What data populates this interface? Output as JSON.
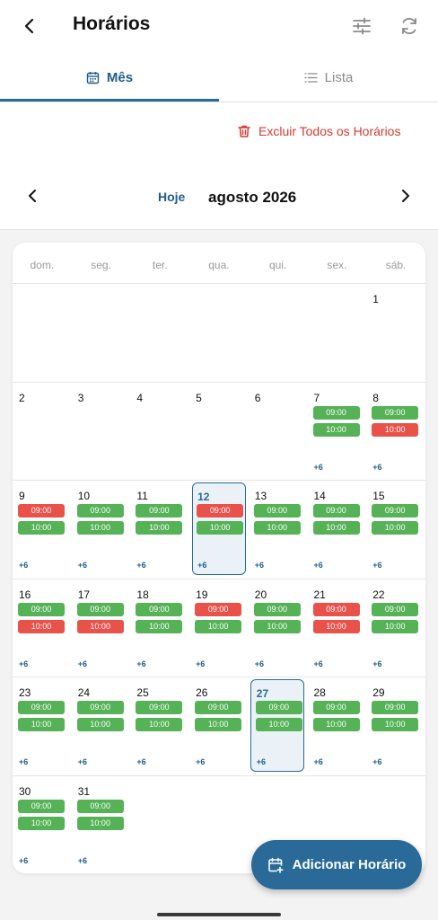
{
  "header": {
    "title": "Horários",
    "back_icon": "chevron-left-icon",
    "filter_icon": "sliders-icon",
    "refresh_icon": "refresh-icon"
  },
  "tabs": [
    {
      "label": "Mês",
      "icon": "calendar-icon",
      "active": true
    },
    {
      "label": "Lista",
      "icon": "list-icon",
      "active": false
    }
  ],
  "actions": {
    "delete_all_label": "Excluir Todos os Horários",
    "today_label": "Hoje",
    "month_label": "agosto 2026"
  },
  "weekdays": [
    "dom.",
    "seg.",
    "ter.",
    "qua.",
    "qui.",
    "sex.",
    "sáb."
  ],
  "first_weekday_index": 6,
  "days_in_month": 31,
  "highlighted_days": [
    12,
    27
  ],
  "slot_times": [
    "09:00",
    "10:00"
  ],
  "slots": {
    "7": [
      "g",
      "g"
    ],
    "8": [
      "g",
      "r"
    ],
    "9": [
      "r",
      "g"
    ],
    "10": [
      "g",
      "g"
    ],
    "11": [
      "g",
      "g"
    ],
    "12": [
      "r",
      "g"
    ],
    "13": [
      "g",
      "g"
    ],
    "14": [
      "g",
      "g"
    ],
    "15": [
      "g",
      "g"
    ],
    "16": [
      "g",
      "r"
    ],
    "17": [
      "g",
      "r"
    ],
    "18": [
      "g",
      "g"
    ],
    "19": [
      "r",
      "g"
    ],
    "20": [
      "g",
      "g"
    ],
    "21": [
      "r",
      "r"
    ],
    "22": [
      "g",
      "g"
    ],
    "23": [
      "g",
      "g"
    ],
    "24": [
      "g",
      "g"
    ],
    "25": [
      "g",
      "g"
    ],
    "26": [
      "g",
      "g"
    ],
    "27": [
      "g",
      "g"
    ],
    "28": [
      "g",
      "g"
    ],
    "29": [
      "g",
      "g"
    ],
    "30": [
      "g",
      "g"
    ],
    "31": [
      "g",
      "g"
    ]
  },
  "more_label": "+6",
  "fab_label": "Adicionar Horário",
  "colors": {
    "accent": "#2a6a98",
    "green": "#55b256",
    "red": "#e8524a",
    "danger_text": "#d63a32"
  }
}
